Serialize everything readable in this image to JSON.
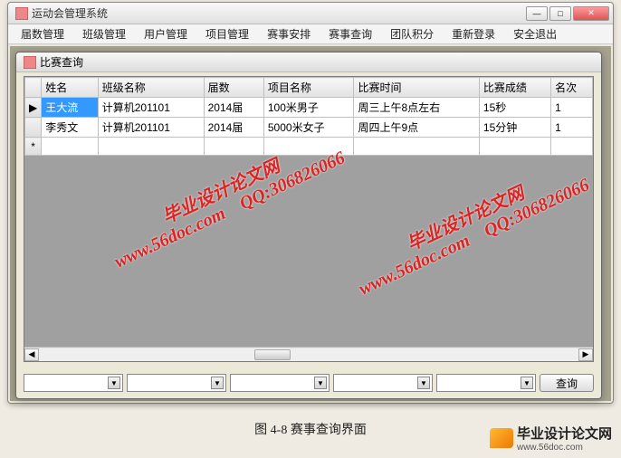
{
  "outer_window": {
    "title": "运动会管理系统"
  },
  "menu": {
    "items": [
      "届数管理",
      "班级管理",
      "用户管理",
      "项目管理",
      "赛事安排",
      "赛事查询",
      "团队积分",
      "重新登录",
      "安全退出"
    ]
  },
  "inner_window": {
    "title": "比赛查询"
  },
  "grid": {
    "headers": [
      "姓名",
      "班级名称",
      "届数",
      "项目名称",
      "比赛时间",
      "比赛成绩",
      "名次"
    ],
    "rows": [
      {
        "name": "王大流",
        "class": "计算机201101",
        "period": "2014届",
        "event": "100米男子",
        "time": "周三上午8点左右",
        "result": "15秒",
        "rank": "1"
      },
      {
        "name": "李秀文",
        "class": "计算机201101",
        "period": "2014届",
        "event": "5000米女子",
        "time": "周四上午9点",
        "result": "15分钟",
        "rank": "1"
      }
    ],
    "newrow_marker": "*"
  },
  "query_button": "查询",
  "watermark": {
    "line1": "毕业设计论文网",
    "line2": "www.56doc.com    QQ:306826066"
  },
  "caption": "图 4-8  赛事查询界面",
  "footer": {
    "brand": "毕业设计论文网",
    "url": "www.56doc.com"
  },
  "icons": {
    "minimize": "—",
    "maximize": "□",
    "close": "✕",
    "selector": "▶",
    "dropdown": "▼",
    "left": "◀",
    "right": "▶"
  }
}
